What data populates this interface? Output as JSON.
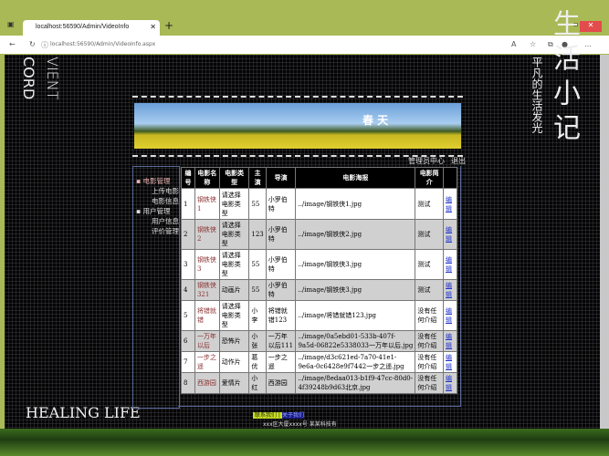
{
  "browser": {
    "tab_title": "localhost:56590/Admin/VideoInfo",
    "url": "localhost:56590/Admin/VideoInfo.aspx"
  },
  "decor": {
    "left_top_a": "VIENT",
    "left_top_b": "CORD",
    "left_bottom": "HEALING LIFE",
    "right_small": "平凡的生活发光",
    "right_big": "生活小记",
    "right_top": "记"
  },
  "banner": {
    "text": "春 天"
  },
  "top_links": {
    "admin_center": "管理员中心",
    "logout": "退出"
  },
  "sidebar": {
    "groups": [
      {
        "label": "电影管理",
        "items": [
          "上传电影",
          "电影信息"
        ]
      },
      {
        "label": "用户管理",
        "items": [
          "用户信息",
          "评价管理"
        ]
      }
    ]
  },
  "table": {
    "headers": [
      "编号",
      "电影名称",
      "电影类型",
      "主演",
      "导演",
      "电影海报",
      "电影简介",
      ""
    ],
    "rows": [
      [
        "1",
        "钢铁侠1",
        "请选择电影类型",
        "55",
        "小罗伯特",
        "../image/钢铁侠1.jpg",
        "测试",
        "编辑"
      ],
      [
        "2",
        "钢铁侠2",
        "请选择电影类型",
        "123",
        "小罗伯特",
        "../image/钢铁侠2.jpg",
        "测试",
        "编辑"
      ],
      [
        "3",
        "钢铁侠3",
        "请选择电影类型",
        "55",
        "小罗伯特",
        "../image/钢铁侠3.jpg",
        "测试",
        "编辑"
      ],
      [
        "4",
        "钢铁侠321",
        "动画片",
        "55",
        "小罗伯特",
        "../image/钢铁侠3.jpg",
        "测试",
        "编辑"
      ],
      [
        "5",
        "将错就错",
        "请选择电影类型",
        "小李",
        "将错就错123",
        "../image/将错就错123.jpg",
        "没有任何介绍",
        "编辑"
      ],
      [
        "6",
        "一万年以后",
        "恐怖片",
        "小张",
        "一万年以后111",
        "../image/0a5ebd01-533b-407f-9a5d-06822e5338033一万年以后.jpg",
        "没有任何介绍",
        "编辑"
      ],
      [
        "7",
        "一步之遥",
        "动作片",
        "葛优",
        "一步之遥",
        "../image/d3c621ed-7a70-41e1-9e6a-0c6428e9f7442一步之遥.jpg",
        "没有任何介绍",
        "编辑"
      ],
      [
        "8",
        "西游园",
        "爱情片",
        "小红",
        "西游园",
        "../image/8edaa013-b1f9-47cc-80d0-4f39248b9d63北京.jpg",
        "没有任何介绍",
        "编辑"
      ]
    ]
  },
  "footer": {
    "contact": "联系我们 |",
    "about": "关于我们",
    "address": "xxx区大厦xxxx号 某某科技有"
  }
}
